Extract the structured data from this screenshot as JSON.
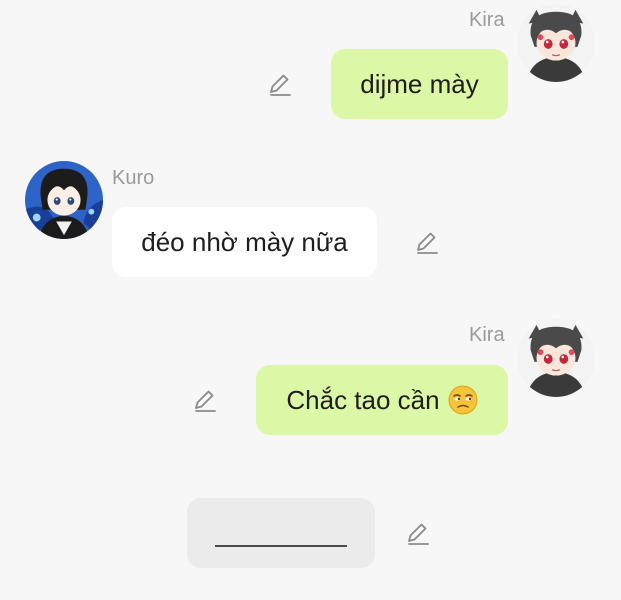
{
  "messages": [
    {
      "sender": "Kira",
      "text": "dijme mày",
      "side": "right",
      "avatar": "kira-avatar"
    },
    {
      "sender": "Kuro",
      "text": "đéo nhờ mày nữa",
      "side": "left",
      "avatar": "kuro-avatar"
    },
    {
      "sender": "Kira",
      "text": "Chắc tao cần",
      "emoji": "unamused-face",
      "side": "right",
      "avatar": "kira-avatar"
    }
  ],
  "draft": {
    "text": ""
  },
  "icons": {
    "edit": "pencil-icon"
  },
  "colors": {
    "background": "#f7f7f7",
    "sent_bubble": "#dcf7a6",
    "received_bubble": "#ffffff",
    "draft_bubble": "#ebebeb",
    "sender_name": "#9a9a9a"
  }
}
